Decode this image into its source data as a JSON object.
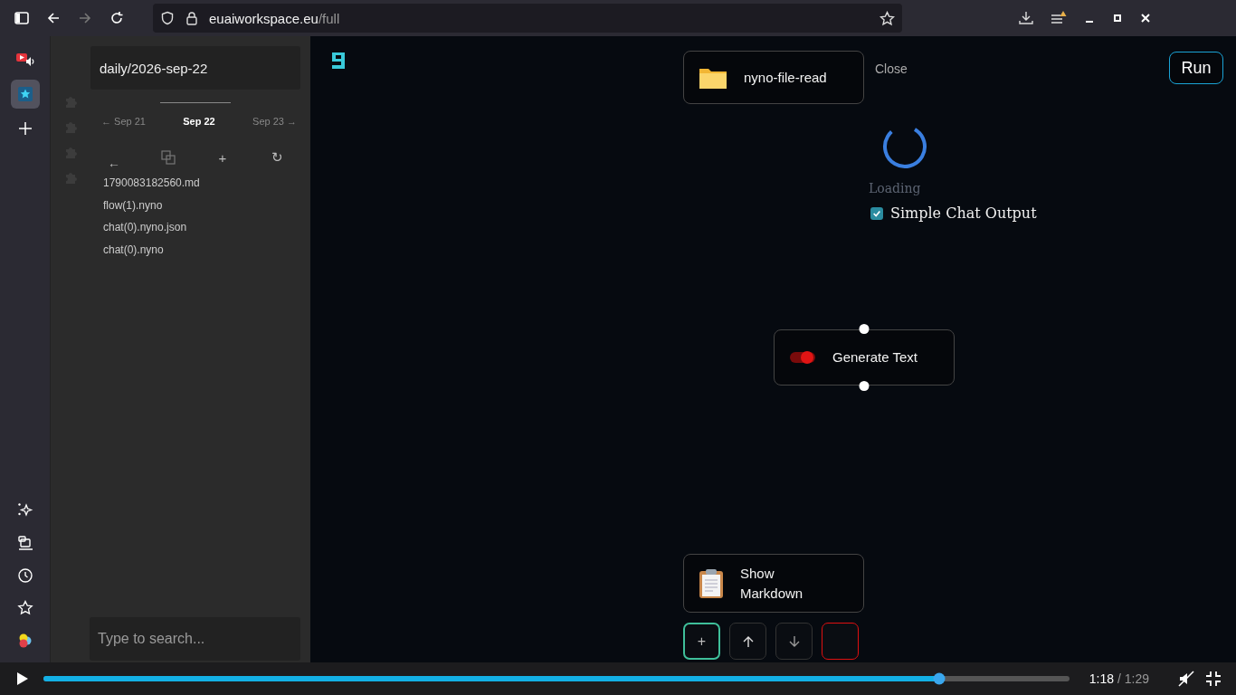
{
  "browser": {
    "url_host": "euaiworkspace.eu",
    "url_path": "/full"
  },
  "sidebar": {
    "top_items": [
      {
        "kind": "media",
        "selected": false
      },
      {
        "kind": "star",
        "selected": true
      },
      {
        "kind": "add",
        "selected": false
      }
    ],
    "bottom_items": [
      {
        "kind": "sparkle"
      },
      {
        "kind": "device"
      },
      {
        "kind": "clock"
      },
      {
        "kind": "star"
      },
      {
        "kind": "colors"
      }
    ]
  },
  "panel": {
    "path": "daily/2026-sep-22",
    "days": [
      {
        "label": "← Sep 21",
        "selected": false
      },
      {
        "label": "Sep 22",
        "selected": true
      },
      {
        "label": "Sep 23 →",
        "selected": false
      }
    ],
    "tools": [
      {
        "kind": "back",
        "label": "←"
      },
      {
        "kind": "copy"
      },
      {
        "kind": "add",
        "label": "+"
      },
      {
        "kind": "refresh",
        "label": "↻"
      }
    ],
    "files": [
      "1790083182560.md",
      "flow(1).nyno",
      "chat(0).nyno.json",
      "chat(0).nyno"
    ],
    "search": {
      "placeholder": "Type to search..."
    }
  },
  "canvas": {
    "nodes": [
      {
        "kind": "folder",
        "label": "nyno-file-read"
      },
      {
        "kind": "toggle",
        "label": "Generate Text"
      },
      {
        "kind": "clipboard",
        "label": "Show Markdown"
      }
    ],
    "close": "Close",
    "run": "Run",
    "loading": "Loading",
    "simple_chat": {
      "label": "Simple Chat Output",
      "checked": true
    },
    "actions": [
      {
        "kind": "add",
        "label": "+"
      },
      {
        "kind": "up"
      },
      {
        "kind": "down"
      },
      {
        "kind": "delete"
      }
    ]
  },
  "player": {
    "level": 0.873,
    "current": "1:18",
    "total": "/ 1:29"
  }
}
